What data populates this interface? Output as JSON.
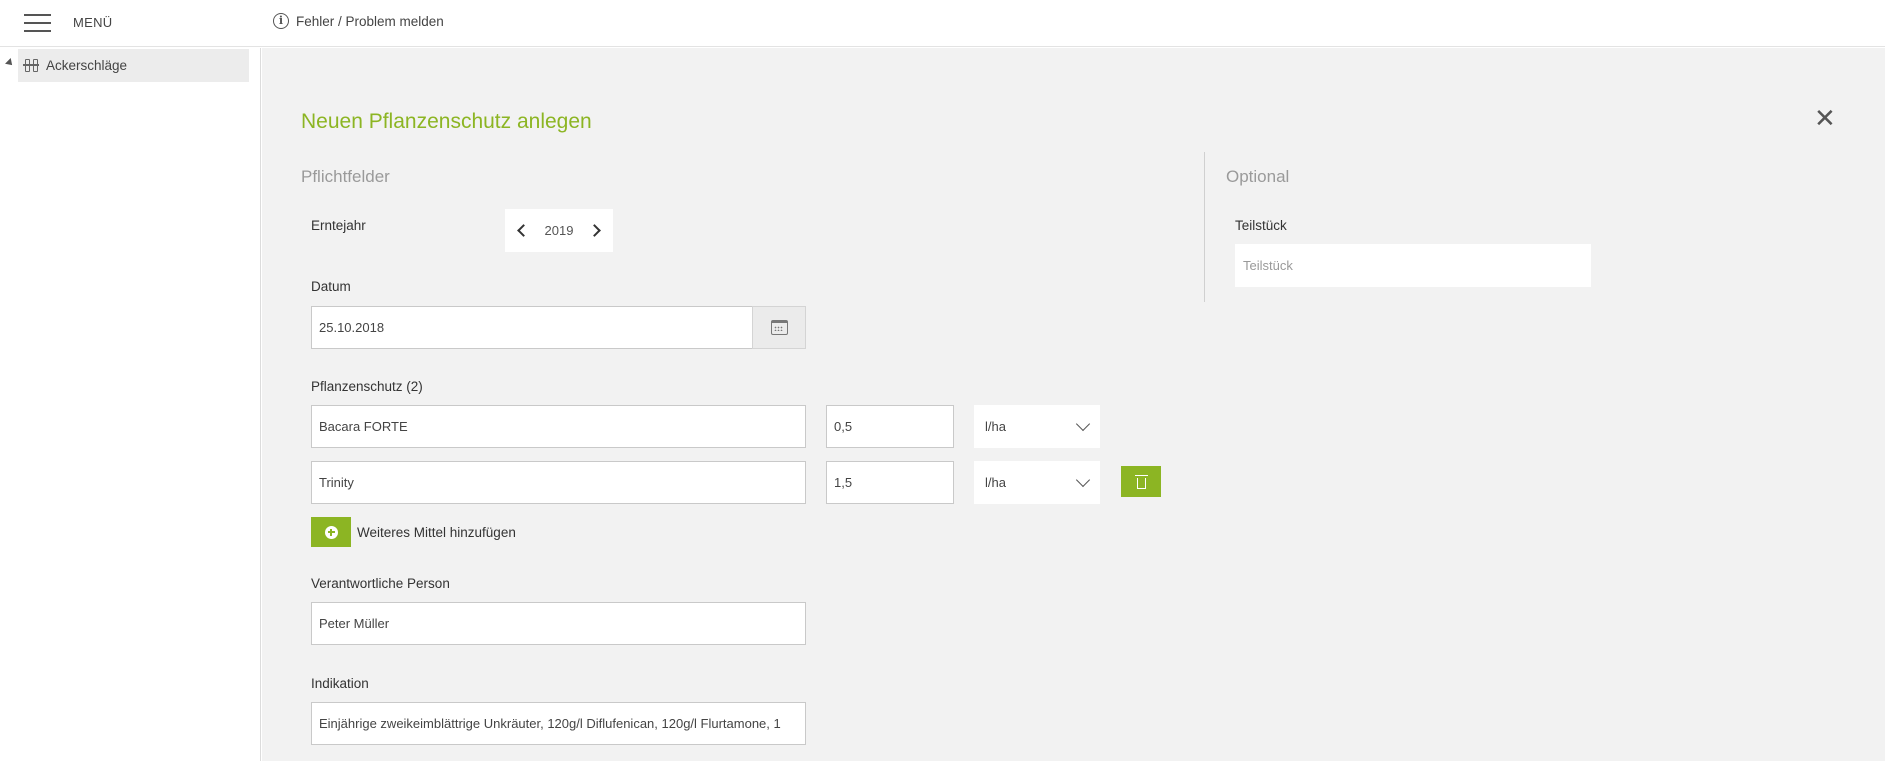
{
  "topbar": {
    "menu_label": "MENÜ",
    "report_label": "Fehler / Problem melden"
  },
  "sidebar": {
    "items": [
      {
        "label": "Ackerschläge",
        "icon": "field-icon"
      }
    ]
  },
  "form": {
    "title": "Neuen Pflanzenschutz anlegen",
    "required_heading": "Pflichtfelder",
    "optional_heading": "Optional",
    "harvest_year": {
      "label": "Erntejahr",
      "value": "2019"
    },
    "date": {
      "label": "Datum",
      "value": "25.10.2018"
    },
    "protection": {
      "label": "Pflanzenschutz (2)",
      "rows": [
        {
          "product": "Bacara FORTE",
          "amount": "0,5",
          "unit": "l/ha"
        },
        {
          "product": "Trinity",
          "amount": "1,5",
          "unit": "l/ha"
        }
      ],
      "add_label": "Weiteres Mittel hinzufügen"
    },
    "responsible": {
      "label": "Verantwortliche Person",
      "value": "Peter Müller"
    },
    "indication": {
      "label": "Indikation",
      "value": "Einjährige zweikeimblättrige Unkräuter, 120g/l Diflufenican, 120g/l Flurtamone, 1"
    },
    "partial": {
      "label": "Teilstück",
      "placeholder": "Teilstück"
    }
  },
  "colors": {
    "accent": "#8cb523",
    "main_bg": "#f2f2f2"
  }
}
